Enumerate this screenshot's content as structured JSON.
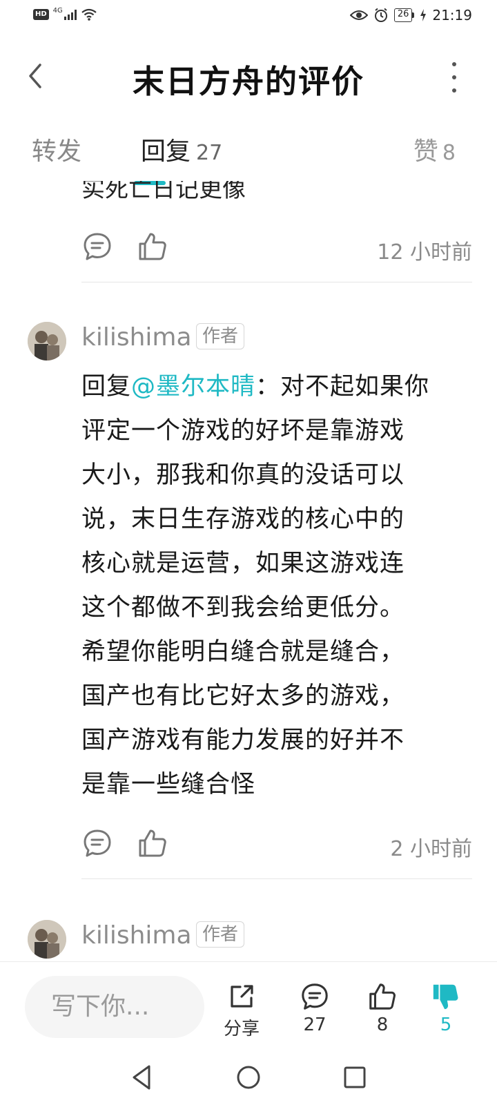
{
  "status_bar": {
    "hd_label": "HD",
    "network_label": "4G",
    "battery_level": "26",
    "time": "21:19"
  },
  "header": {
    "title": "末日方舟的评价"
  },
  "tabs": {
    "forward_label": "转发",
    "reply_label": "回复",
    "reply_count": "27",
    "likes_label": "赞",
    "likes_count": "8"
  },
  "comments": {
    "prev_tail_text": "实死亡日记更像",
    "prev_time": "12 小时前",
    "reply1": {
      "username": "kilishima",
      "badge": "作者",
      "prefix": "回复",
      "mention": "@墨尔本晴",
      "separator": "：",
      "lines": [
        "对不起如果你",
        "评定一个游戏的好坏是靠游戏",
        "大小，那我和你真的没话可以",
        "说，末日生存游戏的核心中的",
        "核心就是运营，如果这游戏连",
        "这个都做不到我会给更低分。",
        "希望你能明白缝合就是缝合，",
        "国产也有比它好太多的游戏，",
        "国产游戏有能力发展的好并不",
        "是靠一些缝合怪"
      ],
      "time": "2 小时前"
    },
    "reply2": {
      "username": "kilishima",
      "badge": "作者"
    }
  },
  "bottom_bar": {
    "input_placeholder": "写下你...",
    "share_label": "分享",
    "comments_count": "27",
    "likes_count": "8",
    "dislikes_count": "5",
    "accent_color": "#1fb9c4"
  },
  "icons": {
    "comment": "comment-icon",
    "like": "thumbs-up-icon",
    "dislike": "thumbs-down-icon",
    "share": "share-icon"
  }
}
